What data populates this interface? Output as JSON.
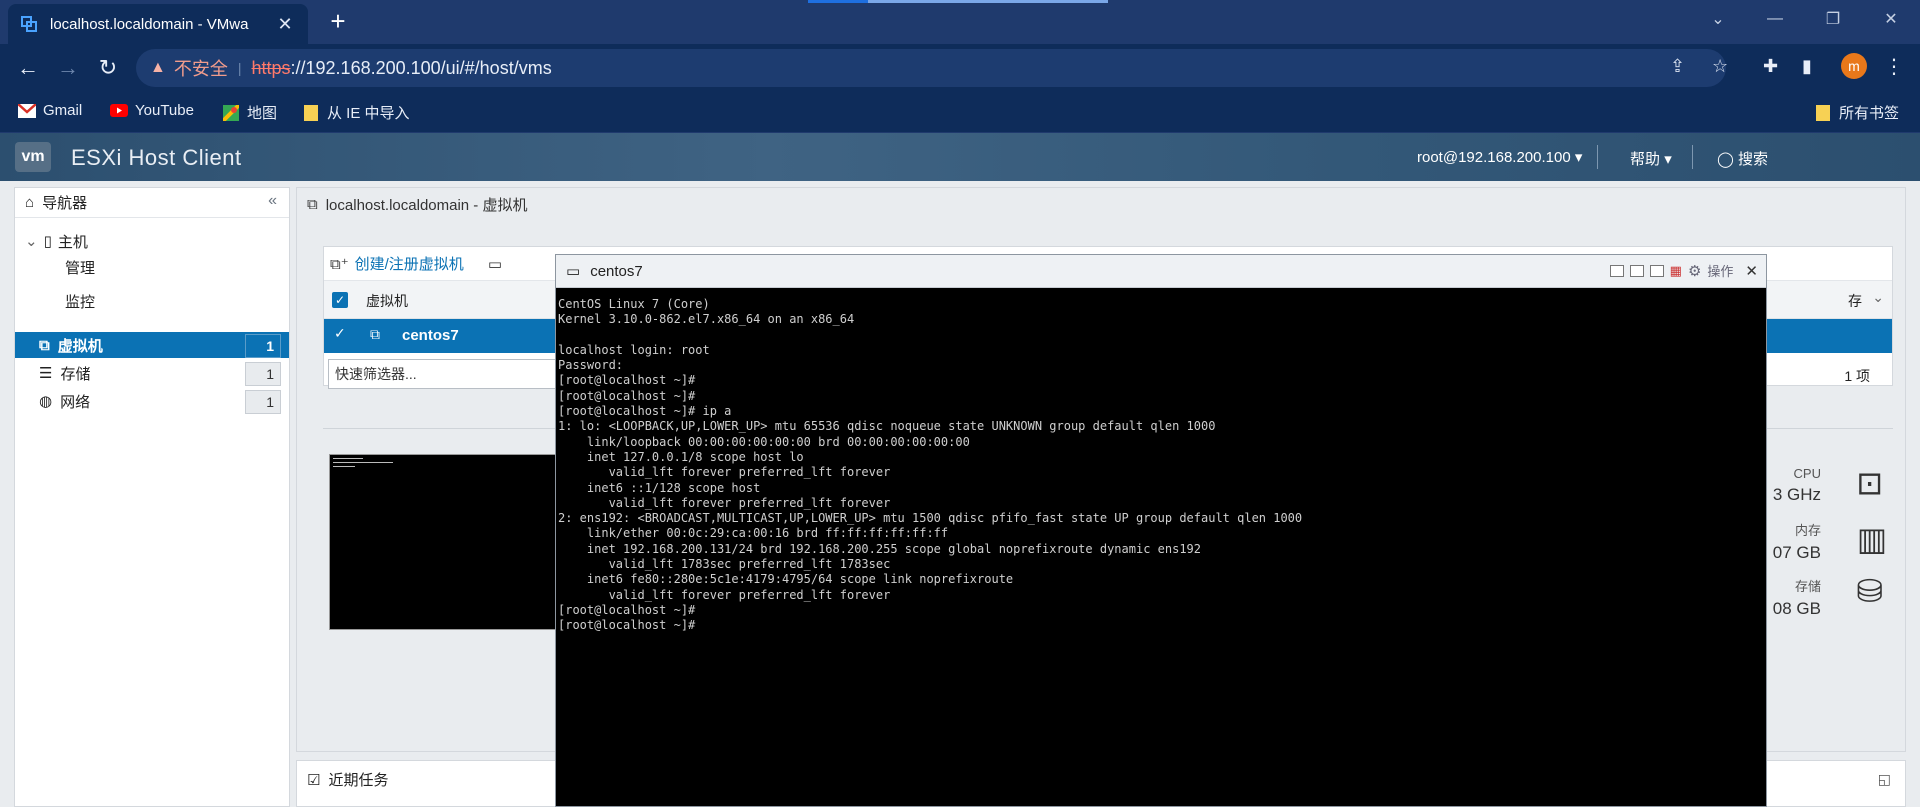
{
  "browser": {
    "tab_title": "localhost.localdomain - VMwa",
    "security_label": "不安全",
    "url_protocol": "https",
    "url_rest": "://192.168.200.100/ui/#/host/vms",
    "avatar_letter": "m",
    "bookmarks": [
      "Gmail",
      "YouTube",
      "地图",
      "从 IE 中导入"
    ],
    "all_bookmarks": "所有书签"
  },
  "esxi": {
    "logo": "vm",
    "title": "ESXi Host Client",
    "user": "root@192.168.200.100",
    "help": "帮助",
    "search": "搜索"
  },
  "navigator": {
    "title": "导航器",
    "host": "主机",
    "manage": "管理",
    "monitor": "监控",
    "items": [
      {
        "label": "虚拟机",
        "count": "1"
      },
      {
        "label": "存储",
        "count": "1"
      },
      {
        "label": "网络",
        "count": "1"
      }
    ]
  },
  "main": {
    "title": "localhost.localdomain - 虚拟机",
    "create_button": "创建/注册虚拟机",
    "col_vm": "虚拟机",
    "col_storage_partial": "存",
    "vm_name": "centos7",
    "filter_placeholder": "快速筛选器...",
    "item_count": "1 项",
    "resources": [
      {
        "label": "CPU",
        "value": "3 GHz"
      },
      {
        "label": "内存",
        "value": "07 GB"
      },
      {
        "label": "存储",
        "value": "08 GB"
      }
    ],
    "recent_tasks": "近期任务"
  },
  "console": {
    "title": "centos7",
    "actions": "操作",
    "lines": [
      "CentOS Linux 7 (Core)",
      "Kernel 3.10.0-862.el7.x86_64 on an x86_64",
      "",
      "localhost login: root",
      "Password:",
      "[root@localhost ~]#",
      "[root@localhost ~]#",
      "[root@localhost ~]# ip a",
      "1: lo: <LOOPBACK,UP,LOWER_UP> mtu 65536 qdisc noqueue state UNKNOWN group default qlen 1000",
      "    link/loopback 00:00:00:00:00:00 brd 00:00:00:00:00:00",
      "    inet 127.0.0.1/8 scope host lo",
      "       valid_lft forever preferred_lft forever",
      "    inet6 ::1/128 scope host",
      "       valid_lft forever preferred_lft forever",
      "2: ens192: <BROADCAST,MULTICAST,UP,LOWER_UP> mtu 1500 qdisc pfifo_fast state UP group default qlen 1000",
      "    link/ether 00:0c:29:ca:00:16 brd ff:ff:ff:ff:ff:ff",
      "    inet 192.168.200.131/24 brd 192.168.200.255 scope global noprefixroute dynamic ens192",
      "       valid_lft 1783sec preferred_lft 1783sec",
      "    inet6 fe80::280e:5c1e:4179:4795/64 scope link noprefixroute",
      "       valid_lft forever preferred_lft forever",
      "[root@localhost ~]#",
      "[root@localhost ~]#"
    ]
  }
}
